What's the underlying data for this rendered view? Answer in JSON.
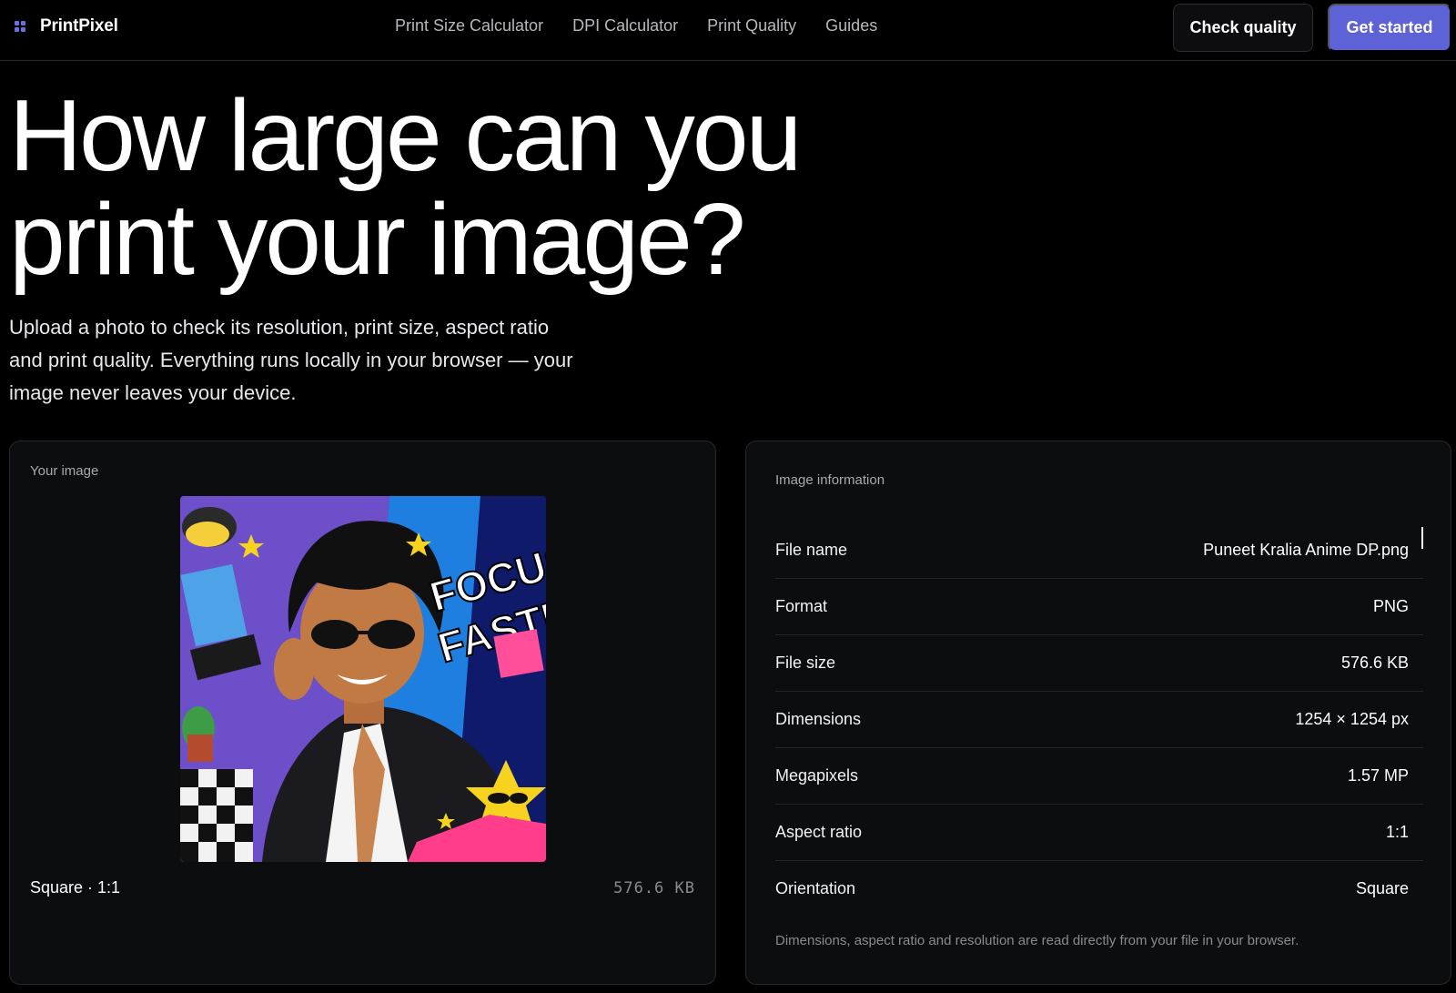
{
  "brand": {
    "name": "PrintPixel",
    "icon": "grid-icon",
    "accent": "#5d62d6"
  },
  "nav": {
    "items": [
      {
        "label": "Print Size Calculator"
      },
      {
        "label": "DPI Calculator"
      },
      {
        "label": "Print Quality"
      },
      {
        "label": "Guides"
      }
    ]
  },
  "header": {
    "check_quality_label": "Check quality",
    "get_started_label": "Get started"
  },
  "hero": {
    "title_line1": "How large can you",
    "title_line2": "print your image?",
    "subtitle_line1": "Upload a photo to check its resolution, print size, aspect ratio",
    "subtitle_line2": "and print quality. Everything runs locally in your browser — your",
    "subtitle_line3": "image never leaves your device."
  },
  "image_card": {
    "label": "Your image",
    "caption": "Square · 1:1",
    "size": "576.6 KB"
  },
  "info_card": {
    "label": "Image information",
    "rows": [
      {
        "key": "File name",
        "value": "Puneet Kralia Anime DP.png"
      },
      {
        "key": "Format",
        "value": "PNG"
      },
      {
        "key": "File size",
        "value": "576.6 KB"
      },
      {
        "key": "Dimensions",
        "value": "1254 × 1254 px"
      },
      {
        "key": "Megapixels",
        "value": "1.57 MP"
      },
      {
        "key": "Aspect ratio",
        "value": "1:1"
      },
      {
        "key": "Orientation",
        "value": "Square"
      }
    ],
    "note": "Dimensions, aspect ratio and resolution are read directly from your file in your browser."
  }
}
